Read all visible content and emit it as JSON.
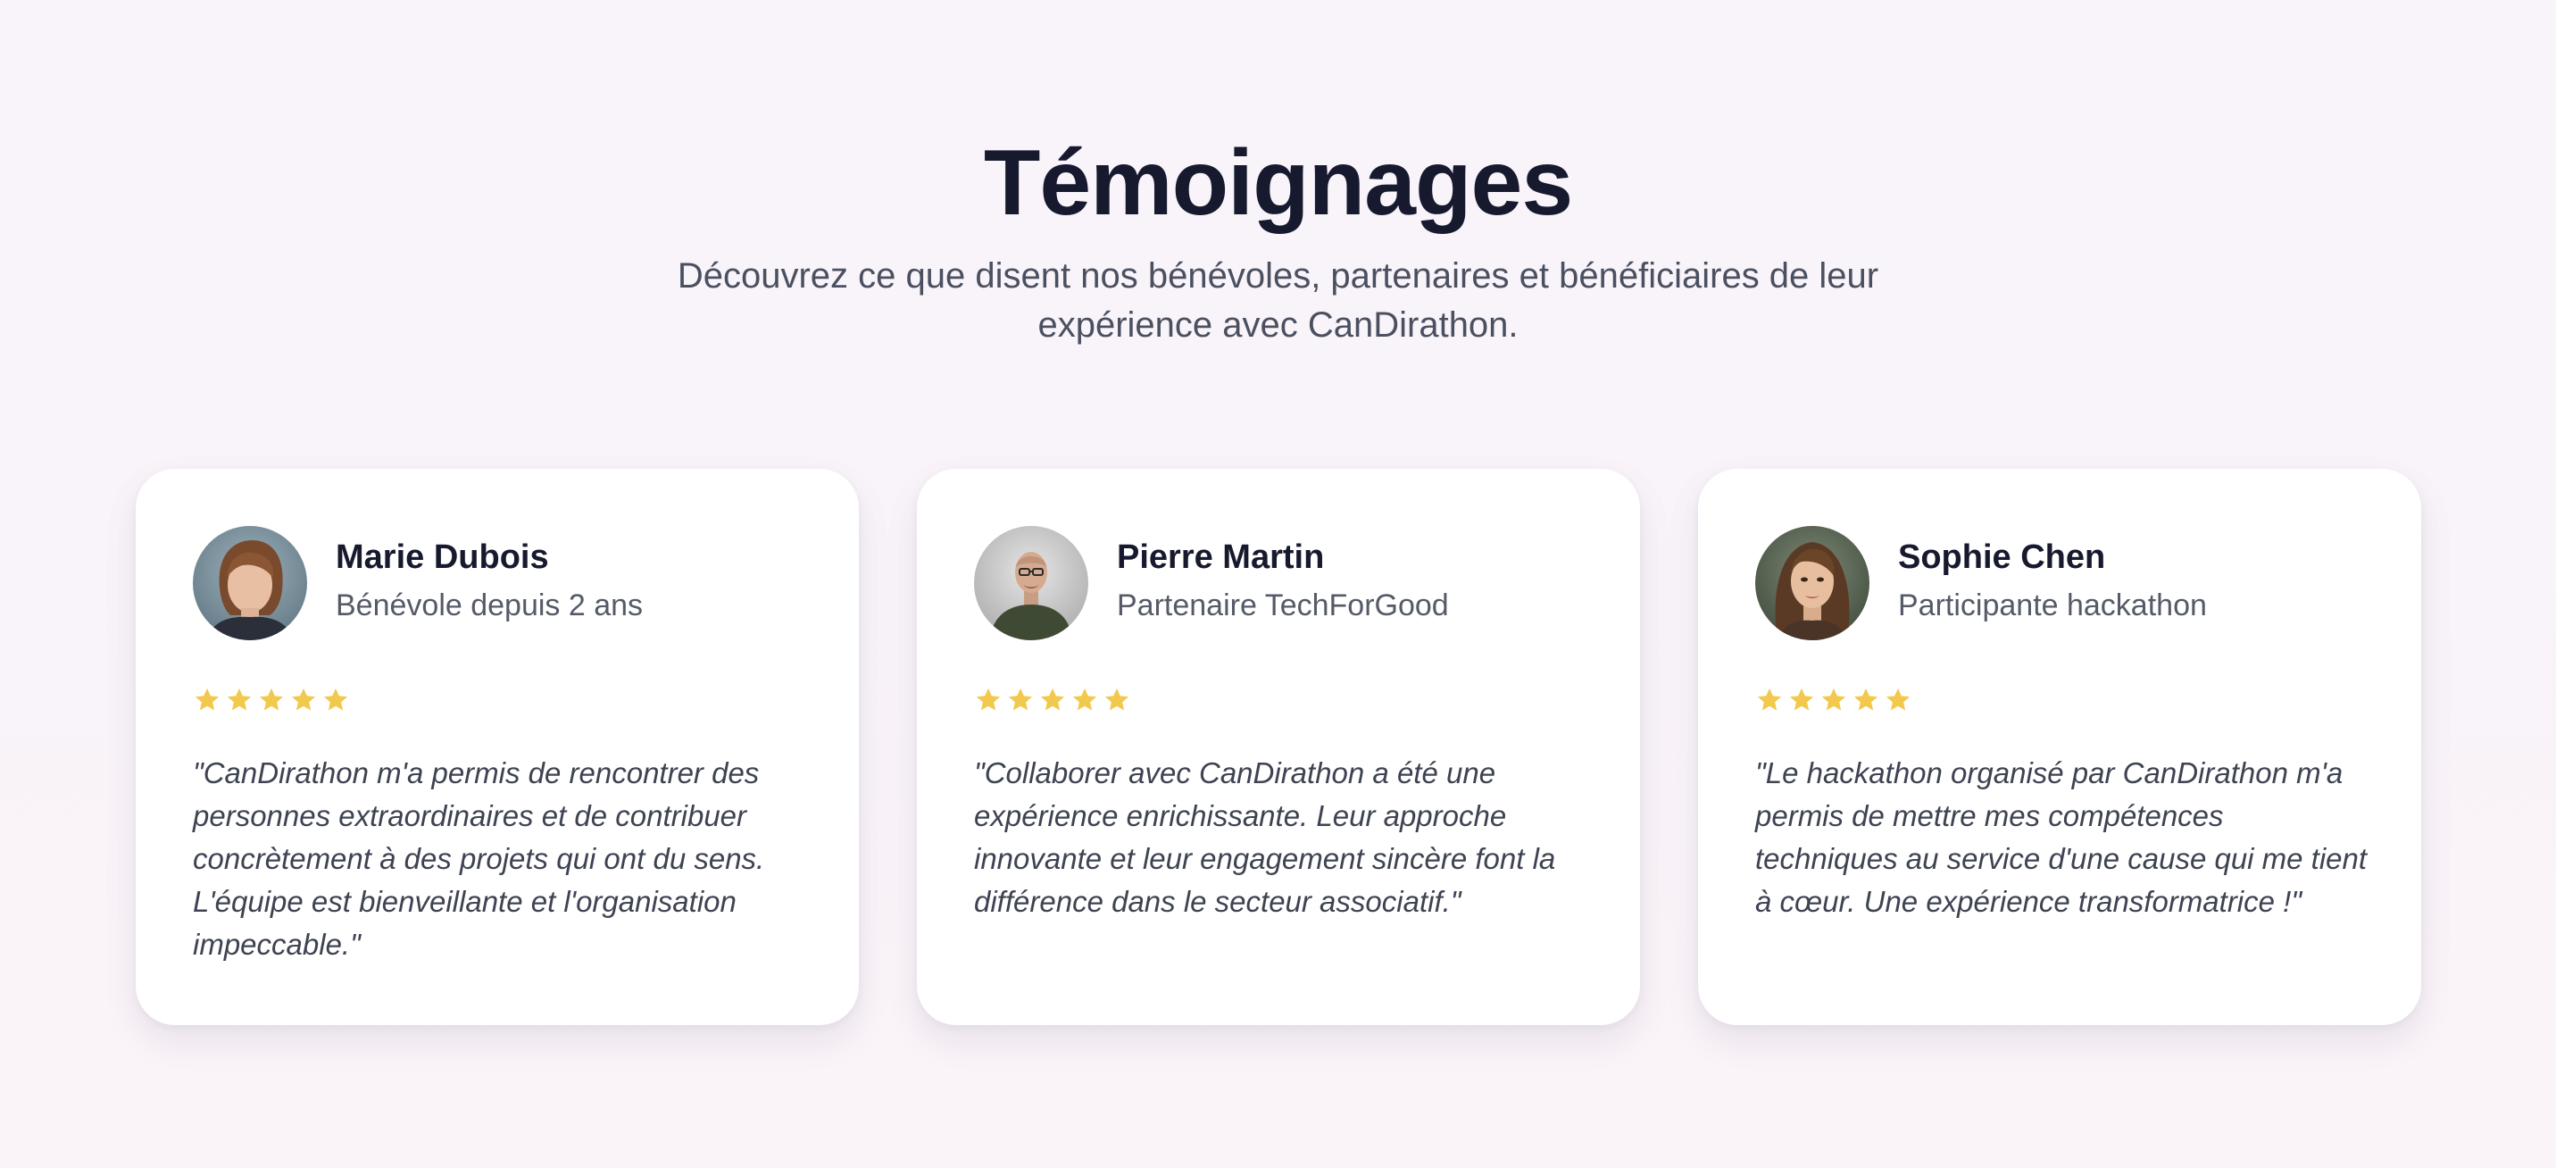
{
  "section": {
    "title": "Témoignages",
    "subtitle": "Découvrez ce que disent nos bénévoles, partenaires et bénéficiaires de leur expérience avec CanDirathon."
  },
  "colors": {
    "star": "#f2c94c",
    "title": "#171a2e",
    "text": "#3e4352",
    "card_background": "#ffffff"
  },
  "testimonials": [
    {
      "name": "Marie Dubois",
      "role": "Bénévole depuis 2 ans",
      "rating": 5,
      "quote": "\"CanDirathon m'a permis de rencontrer des personnes extraordinaires et de contribuer concrètement à des projets qui ont du sens. L'équipe est bienveillante et l'organisation impeccable.\""
    },
    {
      "name": "Pierre Martin",
      "role": "Partenaire TechForGood",
      "rating": 5,
      "quote": "\"Collaborer avec CanDirathon a été une expérience enrichissante. Leur approche innovante et leur engagement sincère font la différence dans le secteur associatif.\""
    },
    {
      "name": "Sophie Chen",
      "role": "Participante hackathon",
      "rating": 5,
      "quote": "\"Le hackathon organisé par CanDirathon m'a permis de mettre mes compétences techniques au service d'une cause qui me tient à cœur. Une expérience transformatrice !\""
    }
  ]
}
